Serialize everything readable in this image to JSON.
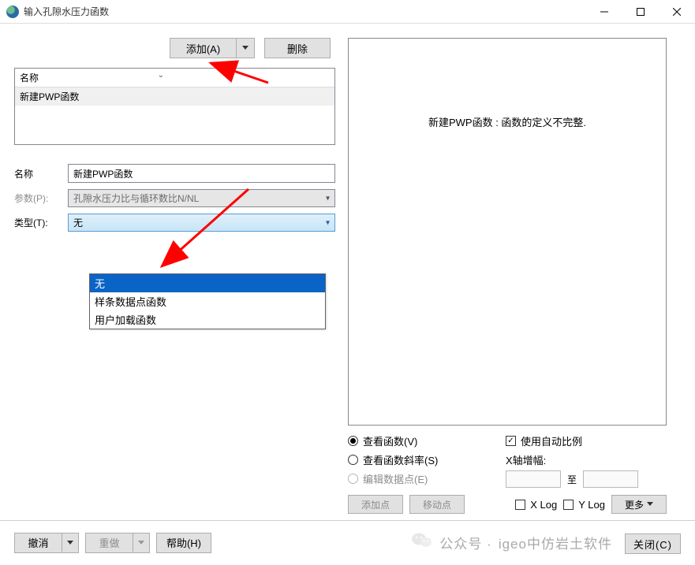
{
  "window": {
    "title": "输入孔隙水压力函数"
  },
  "toolbar": {
    "add_label": "添加(A)",
    "delete_label": "删除"
  },
  "list": {
    "header_name": "名称",
    "row0": "新建PWP函数"
  },
  "form": {
    "name_label": "名称",
    "name_value": "新建PWP函数",
    "param_label": "参数(P):",
    "param_value": "孔隙水压力比与循环数比N/NL",
    "type_label": "类型(T):",
    "type_value": "无"
  },
  "type_options": {
    "opt0": "无",
    "opt1": "样条数据点函数",
    "opt2": "用户加载函数"
  },
  "preview": {
    "message": "新建PWP函数 : 函数的定义不完整."
  },
  "right_controls": {
    "view_fn": "查看函数(V)",
    "view_slope": "查看函数斜率(S)",
    "edit_points": "编辑数据点(E)",
    "auto_scale": "使用自动比例",
    "x_zoom": "X轴增幅:",
    "to_label": "至",
    "add_point": "添加点",
    "move_point": "移动点",
    "xlog": "X Log",
    "ylog": "Y Log",
    "more": "更多"
  },
  "footer": {
    "undo": "撤消",
    "redo": "重做",
    "help": "帮助(H)",
    "close": "关闭(C)",
    "watermark_prefix": "公众号 · ",
    "watermark_brand": "igeo中仿岩土软件"
  }
}
